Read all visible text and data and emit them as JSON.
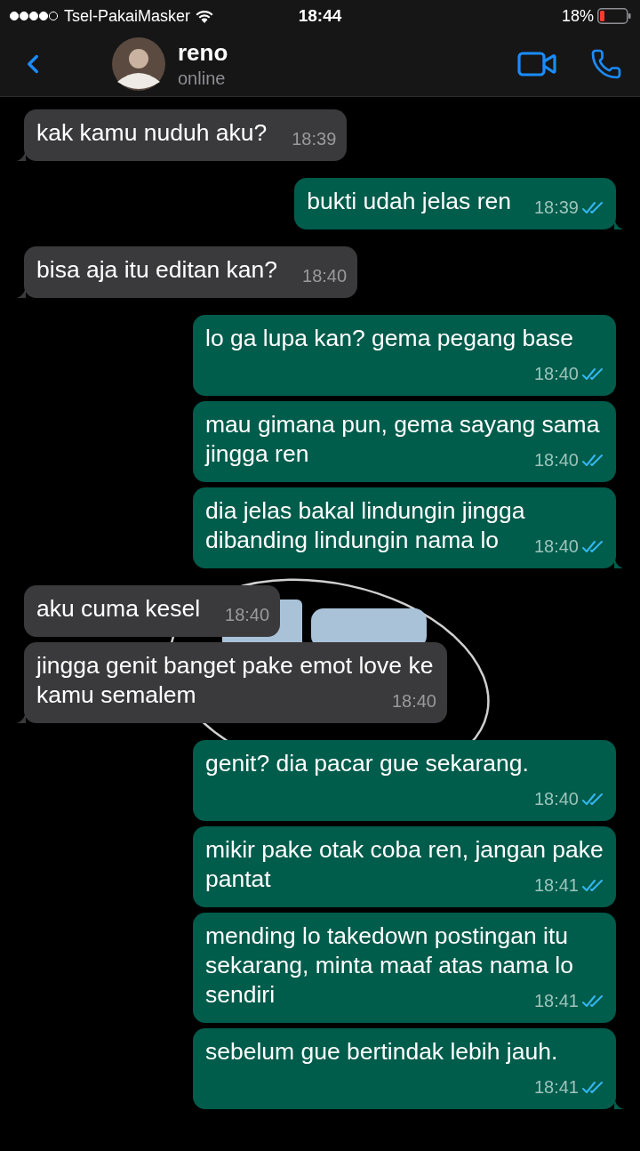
{
  "status_bar": {
    "carrier": "Tsel-PakaiMasker",
    "time": "18:44",
    "battery": "18%"
  },
  "header": {
    "name": "reno",
    "status": "online"
  },
  "messages": [
    {
      "outgoing": false,
      "text": "kak kamu nuduh aku?",
      "time": "18:39"
    },
    {
      "outgoing": true,
      "text": "bukti udah jelas ren",
      "time": "18:39",
      "read": true
    },
    {
      "outgoing": false,
      "text": "bisa aja itu editan kan?",
      "time": "18:40"
    },
    {
      "outgoing": true,
      "text": "lo ga lupa kan? gema pegang base",
      "time": "18:40",
      "read": true
    },
    {
      "outgoing": true,
      "text": "mau gimana pun, gema sayang sama jingga ren",
      "time": "18:40",
      "read": true
    },
    {
      "outgoing": true,
      "text": "dia jelas bakal lindungin jingga dibanding lindungin nama lo",
      "time": "18:40",
      "read": true
    },
    {
      "outgoing": false,
      "text": "aku cuma kesel",
      "time": "18:40"
    },
    {
      "outgoing": false,
      "text": "jingga genit banget pake emot love ke kamu semalem",
      "time": "18:40"
    },
    {
      "outgoing": true,
      "text": "genit? dia pacar gue sekarang.",
      "time": "18:40",
      "read": true
    },
    {
      "outgoing": true,
      "text": "mikir pake otak coba ren, jangan pake pantat",
      "time": "18:41",
      "read": true
    },
    {
      "outgoing": true,
      "text": "mending lo takedown postingan itu sekarang, minta maaf atas nama lo sendiri",
      "time": "18:41",
      "read": true
    },
    {
      "outgoing": true,
      "text": "sebelum gue bertindak lebih jauh.",
      "time": "18:41",
      "read": true
    }
  ]
}
